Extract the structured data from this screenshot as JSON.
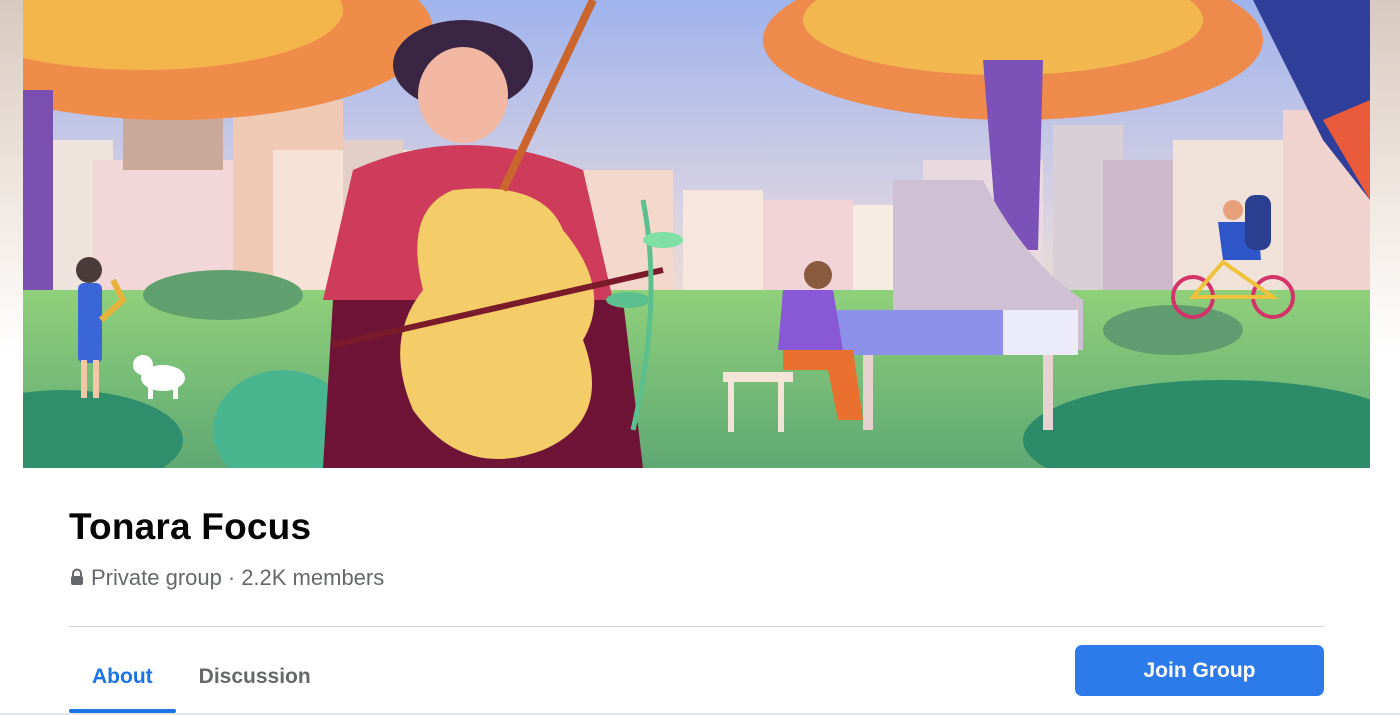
{
  "cover": {
    "image_description": "Illustrated park scene with a cellist, pianist, saxophonist, dog and cyclist",
    "colors": {
      "sky": "#a9bde8",
      "grass": "#8fcf7a",
      "tree_orange": "#ef9b4d"
    }
  },
  "group": {
    "name": "Tonara Focus",
    "privacy": "Private group",
    "separator": "·",
    "members": "2.2K members"
  },
  "tabs": [
    {
      "label": "About",
      "active": true
    },
    {
      "label": "Discussion",
      "active": false
    }
  ],
  "actions": {
    "join_label": "Join Group",
    "accent": "#2d7bea"
  },
  "icons": {
    "privacy_icon": "lock-icon"
  }
}
